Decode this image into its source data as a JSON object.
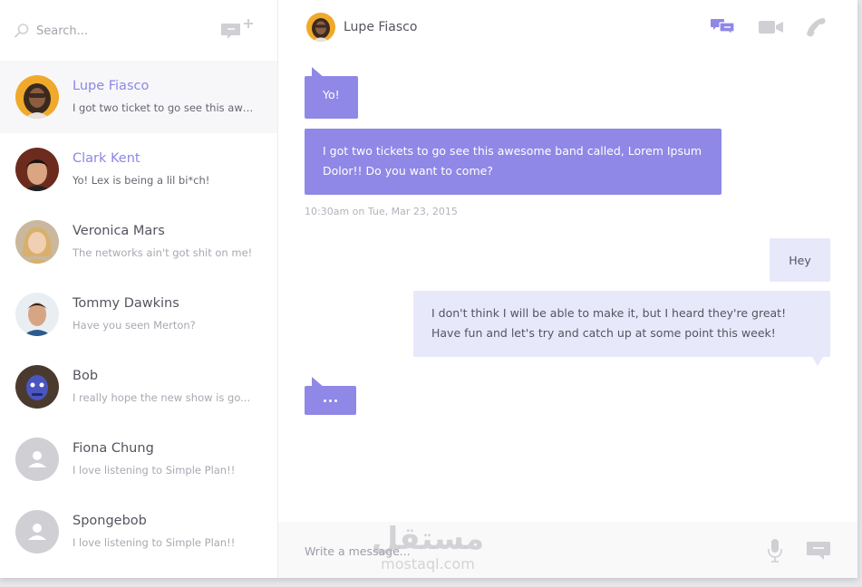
{
  "sidebar": {
    "search_placeholder": "Search...",
    "contacts": [
      {
        "name": "Lupe Fiasco",
        "preview": "I got two ticket to go see this awe..."
      },
      {
        "name": "Clark Kent",
        "preview": "Yo! Lex is being a lil bi*ch!"
      },
      {
        "name": "Veronica Mars",
        "preview": "The networks ain't got shit on me!"
      },
      {
        "name": "Tommy Dawkins",
        "preview": "Have you seen Merton?"
      },
      {
        "name": "Bob",
        "preview": "I really hope the new show is go..."
      },
      {
        "name": "Fiona Chung",
        "preview": "I love listening to Simple Plan!!"
      },
      {
        "name": "Spongebob",
        "preview": "I love listening to Simple Plan!!"
      }
    ]
  },
  "chat": {
    "contact_name": "Lupe Fiasco",
    "messages": [
      {
        "direction": "in",
        "text": "Yo!"
      },
      {
        "direction": "in",
        "text": "I got two tickets to go see this awesome band called, Lorem Ipsum Dolor!! Do you want to come?"
      },
      {
        "direction": "out",
        "text": "Hey"
      },
      {
        "direction": "out",
        "text": "I don't think I will be able to make it, but I heard they're great! Have fun and let's try and catch up at some point this week!"
      }
    ],
    "timestamp": "10:30am on Tue, Mar 23, 2015",
    "composer_placeholder": "Write a message..."
  },
  "watermark": {
    "arabic": "مستقل",
    "latin": "mostaql.com"
  },
  "colors": {
    "accent": "#8f88e6",
    "accent_text": "#8c87e5",
    "outgoing_bubble": "#e8e8fb",
    "icon_gray": "#cfcfd4"
  },
  "icons": [
    "search-icon",
    "new-chat-icon",
    "chat-icon",
    "video-icon",
    "phone-icon",
    "microphone-icon",
    "send-message-icon"
  ]
}
